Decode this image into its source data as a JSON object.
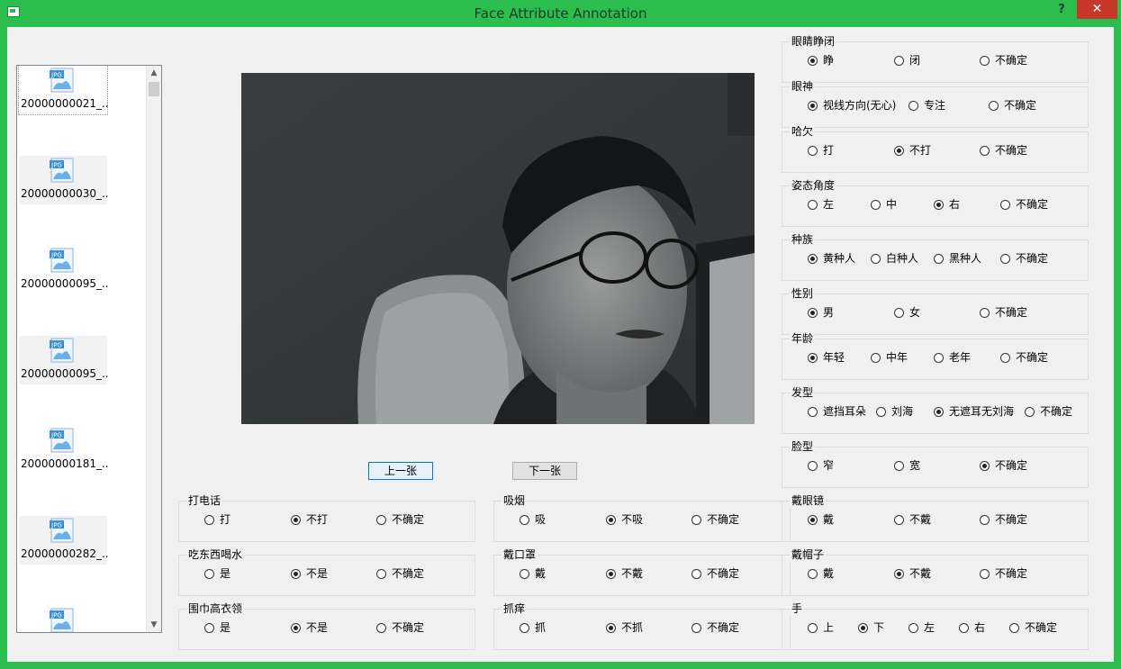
{
  "window": {
    "title": "Face Attribute Annotation",
    "help": "?",
    "close": "✕"
  },
  "files": [
    "20000000021_...",
    "20000000030_...",
    "20000000095_...",
    "20000000095_...",
    "20000000181_...",
    "20000000282_...",
    ""
  ],
  "file_icon_text": "JPG",
  "scroll": {
    "up": "▲",
    "down": "▼"
  },
  "nav": {
    "prev": "上一张",
    "next": "下一张"
  },
  "bottom_groups": [
    {
      "title": "打电话",
      "options": [
        "打",
        "不打",
        "不确定"
      ],
      "selected": 1
    },
    {
      "title": "吸烟",
      "options": [
        "吸",
        "不吸",
        "不确定"
      ],
      "selected": 1
    },
    {
      "title": "吃东西喝水",
      "options": [
        "是",
        "不是",
        "不确定"
      ],
      "selected": 1
    },
    {
      "title": "戴口罩",
      "options": [
        "戴",
        "不戴",
        "不确定"
      ],
      "selected": 1
    },
    {
      "title": "围巾高衣领",
      "options": [
        "是",
        "不是",
        "不确定"
      ],
      "selected": 1
    },
    {
      "title": "抓痒",
      "options": [
        "抓",
        "不抓",
        "不确定"
      ],
      "selected": 1
    }
  ],
  "right_groups": [
    {
      "title": "眼睛睁闭",
      "options": [
        "睁",
        "闭",
        "不确定"
      ],
      "selected": 0
    },
    {
      "title": "眼神",
      "options": [
        "视线方向(无心)",
        "专注",
        "不确定"
      ],
      "selected": 0
    },
    {
      "title": "哈欠",
      "options": [
        "打",
        "不打",
        "不确定"
      ],
      "selected": 1
    },
    {
      "title": "姿态角度",
      "options": [
        "左",
        "中",
        "右",
        "不确定"
      ],
      "selected": 2
    },
    {
      "title": "种族",
      "options": [
        "黄种人",
        "白种人",
        "黑种人",
        "不确定"
      ],
      "selected": 0
    },
    {
      "title": "性别",
      "options": [
        "男",
        "女",
        "不确定"
      ],
      "selected": 0
    },
    {
      "title": "年龄",
      "options": [
        "年轻",
        "中年",
        "老年",
        "不确定"
      ],
      "selected": 0
    },
    {
      "title": "发型",
      "options": [
        "遮挡耳朵",
        "刘海",
        "无遮耳无刘海",
        "不确定"
      ],
      "selected": 2
    },
    {
      "title": "脸型",
      "options": [
        "窄",
        "宽",
        "不确定"
      ],
      "selected": 2
    },
    {
      "title": "戴眼镜",
      "options": [
        "戴",
        "不戴",
        "不确定"
      ],
      "selected": 0
    },
    {
      "title": "戴帽子",
      "options": [
        "戴",
        "不戴",
        "不确定"
      ],
      "selected": 1
    },
    {
      "title": "手",
      "options": [
        "上",
        "下",
        "左",
        "右",
        "不确定"
      ],
      "selected": 1
    }
  ]
}
